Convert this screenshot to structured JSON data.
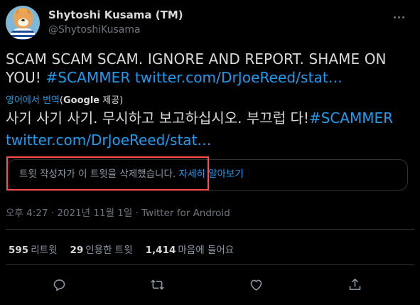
{
  "author": {
    "display_name": "Shytoshi Kusama (TM)",
    "handle": "@ShytoshiKusama",
    "avatar_icon": "shiba-avatar"
  },
  "tweet": {
    "text_plain": "SCAM SCAM SCAM. IGNORE AND REPORT. SHAME ON YOU!",
    "hashtag": "#SCAMMER",
    "link": "twitter.com/DrJoeReed/stat…"
  },
  "translation": {
    "source_label": "영어에서 번역",
    "by_prefix": "(",
    "provider": "Google",
    "by_suffix": " 제공)",
    "text_plain": "사기 사기 사기. 무시하고 보고하십시오. 부끄럽 다!",
    "hashtag": "#SCAMMER",
    "link": "twitter.com/DrJoeReed/stat…"
  },
  "deleted_notice": {
    "text": "트윗 작성자가 이 트윗을 삭제했습니다.",
    "learn_more": "자세히 알아보기"
  },
  "meta": {
    "time": "오후 4:27",
    "date": "2021년 11월 1일",
    "separator": " · ",
    "source": "Twitter for Android"
  },
  "stats": {
    "retweets_count": "595",
    "retweets_label": "리트윗",
    "quotes_count": "29",
    "quotes_label": "인용한 트윗",
    "likes_count": "1,414",
    "likes_label": "마음에 들어요"
  },
  "actions": [
    "reply-icon",
    "retweet-icon",
    "like-icon",
    "share-icon"
  ],
  "colors": {
    "background": "#000000",
    "text": "#d9d9d9",
    "muted": "#6e767d",
    "link": "#1d9bf0",
    "highlight": "#ff4d4f"
  }
}
